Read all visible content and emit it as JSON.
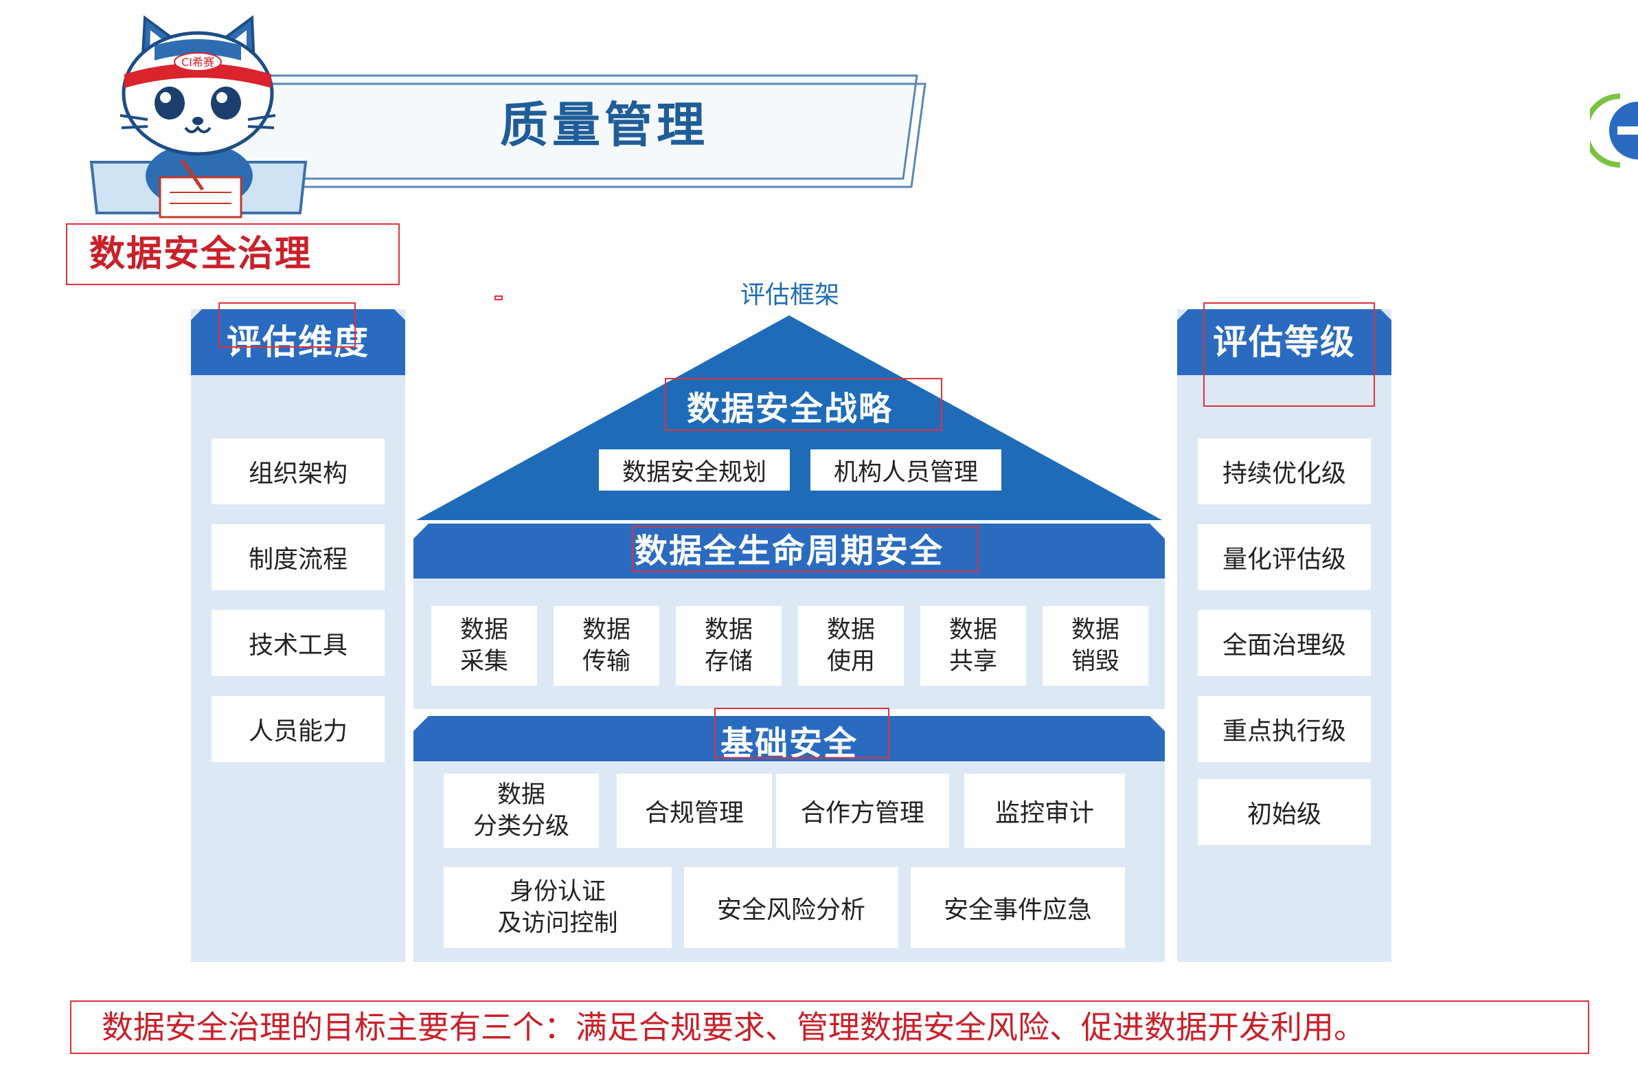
{
  "header": {
    "title": "质量管理",
    "subtitle": "数据安全治理",
    "mascot_badge": "CI希赛"
  },
  "framework": {
    "label": "评估框架",
    "strategy": {
      "title": "数据安全战略",
      "items": [
        "数据安全规划",
        "机构人员管理"
      ]
    },
    "lifecycle": {
      "title": "数据全生命周期安全",
      "items": [
        [
          "数据",
          "采集"
        ],
        [
          "数据",
          "传输"
        ],
        [
          "数据",
          "存储"
        ],
        [
          "数据",
          "使用"
        ],
        [
          "数据",
          "共享"
        ],
        [
          "数据",
          "销毁"
        ]
      ]
    },
    "foundation": {
      "title": "基础安全",
      "row1": [
        "数据分类分级",
        "合规管理",
        "合作方管理",
        "监控审计"
      ],
      "row1_split": [
        "数据",
        "分类分级"
      ],
      "row2": [
        "身份认证及访问控制",
        "安全风险分析",
        "安全事件应急"
      ],
      "row2_split": [
        "身份认证",
        "及访问控制"
      ]
    }
  },
  "dimensions": {
    "title": "评估维度",
    "items": [
      "组织架构",
      "制度流程",
      "技术工具",
      "人员能力"
    ]
  },
  "levels": {
    "title": "评估等级",
    "items": [
      "持续优化级",
      "量化评估级",
      "全面治理级",
      "重点执行级",
      "初始级"
    ]
  },
  "footer": {
    "goal_text": "数据安全治理的目标主要有三个：满足合规要求、管理数据安全风险、促进数据开发利用。"
  },
  "colors": {
    "primary_blue": "#2a6bc0",
    "panel_bg": "#dde8f5",
    "highlight_red": "#e0303a",
    "title_blue": "#1f5d98"
  }
}
